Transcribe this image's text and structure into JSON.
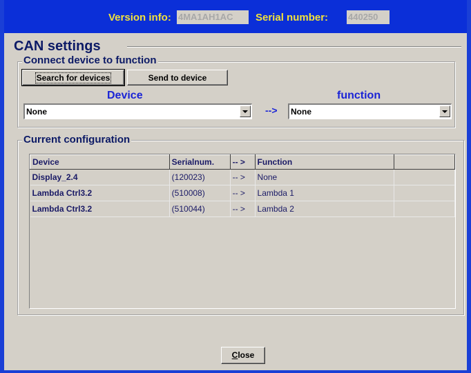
{
  "titlebar": {
    "version_label": "Version info:",
    "version_value": "4MA1AH1AC",
    "serial_label": "Serial number:",
    "serial_value": "440250"
  },
  "page": {
    "heading": "CAN settings"
  },
  "connect_group": {
    "legend": "Connect device to function",
    "search_button": "Search for devices",
    "send_button": "Send to device",
    "device_header": "Device",
    "function_header": "function",
    "device_select": "None",
    "map_arrow": "-->",
    "function_select": "None"
  },
  "config_group": {
    "legend": "Current configuration",
    "columns": [
      "Device",
      "Serialnum.",
      "-- >",
      "Function",
      ""
    ],
    "rows": [
      {
        "device": "Display_2.4",
        "serial": "(120023)",
        "arrow": "-- >",
        "function": "None"
      },
      {
        "device": "Lambda Ctrl3.2",
        "serial": "(510008)",
        "arrow": "-- >",
        "function": "Lambda 1"
      },
      {
        "device": "Lambda Ctrl3.2",
        "serial": "(510044)",
        "arrow": "-- >",
        "function": "Lambda 2"
      }
    ]
  },
  "footer": {
    "close_mnemonic": "C",
    "close_rest": "lose"
  },
  "colors": {
    "titlebar_bg": "#0b2fd8",
    "title_text": "#f2e23a",
    "accent_blue": "#1a24d6",
    "dialog_bg": "#d4d0c8"
  }
}
